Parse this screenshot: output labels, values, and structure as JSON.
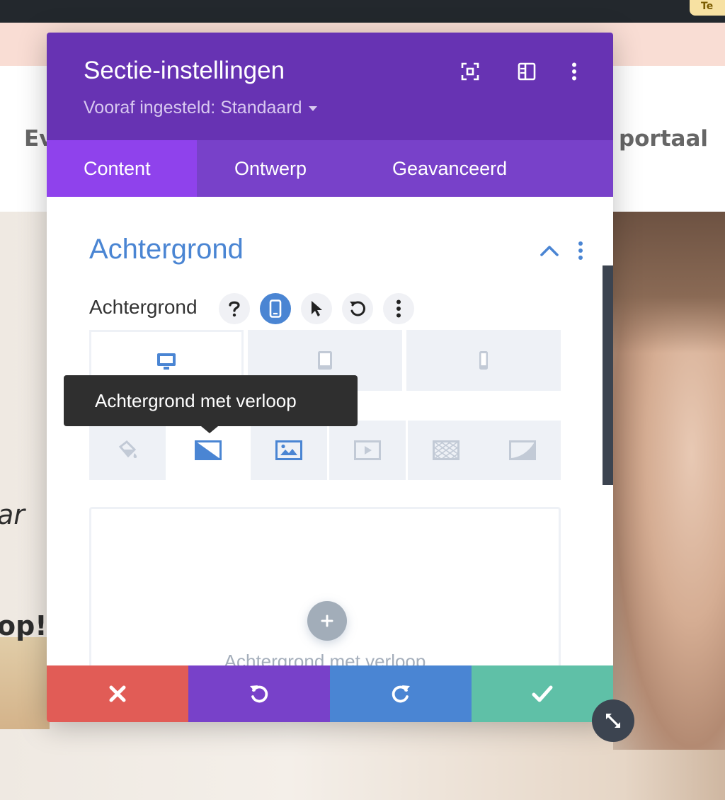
{
  "background_page": {
    "topbar_pill": "Te",
    "nav_left_text": "Ev",
    "nav_right_text": "n portaal",
    "hero_text_1": "ar",
    "hero_text_2": "op!"
  },
  "modal": {
    "title": "Sectie-instellingen",
    "preset_label": "Vooraf ingesteld: Standaard",
    "header_icons": [
      "focus-mode-icon",
      "split-view-icon",
      "more-options-icon"
    ],
    "tabs": [
      {
        "label": "Content",
        "active": true
      },
      {
        "label": "Ontwerp",
        "active": false
      },
      {
        "label": "Geavanceerd",
        "active": false
      }
    ],
    "section": {
      "title": "Achtergrond",
      "field_label": "Achtergrond",
      "field_controls": [
        "help-icon",
        "responsive-icon",
        "hover-icon",
        "reset-icon",
        "more-options-icon"
      ],
      "devices": [
        {
          "name": "desktop-icon",
          "active": true
        },
        {
          "name": "tablet-icon",
          "active": false
        },
        {
          "name": "phone-icon",
          "active": false
        }
      ],
      "background_types": [
        {
          "name": "color-fill-icon",
          "active": false
        },
        {
          "name": "gradient-icon",
          "active": true
        },
        {
          "name": "image-icon",
          "active": false
        },
        {
          "name": "video-icon",
          "active": false
        },
        {
          "name": "pattern-icon",
          "active": false
        },
        {
          "name": "mask-icon",
          "active": false
        }
      ],
      "gradient_placeholder": "Achtergrond met verloop"
    },
    "tooltip": "Achtergrond met verloop",
    "footer": [
      "discard-icon",
      "undo-icon",
      "redo-icon",
      "save-icon"
    ]
  },
  "colors": {
    "header": "#6733b3",
    "tabs": "#7841c9",
    "active_tab": "#8f42ec",
    "accent_blue": "#4a85d3",
    "discard": "#e15c56",
    "undo": "#7841c9",
    "redo": "#4a85d3",
    "save": "#5fc0a7"
  }
}
